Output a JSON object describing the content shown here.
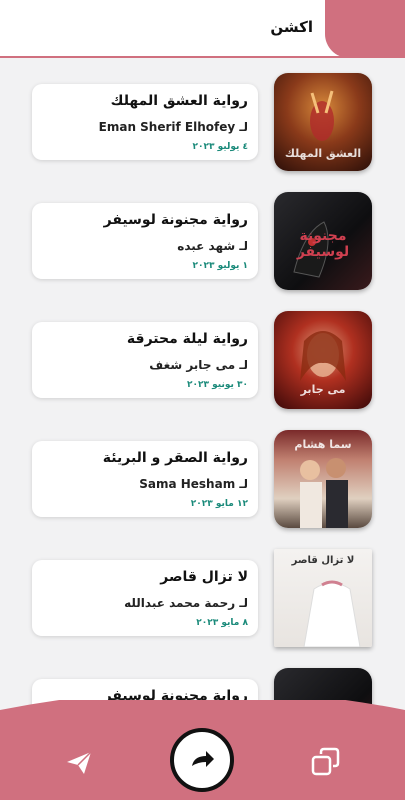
{
  "header": {
    "title": "اكشن"
  },
  "items": [
    {
      "title": "رواية العشق المهلك",
      "author": "لـ Eman Sherif Elhofey",
      "date": "٤ يوليو ٢٠٢٣"
    },
    {
      "title": "رواية مجنونة لوسيفر",
      "author": "لـ شهد عبده",
      "date": "١ يوليو ٢٠٢٣"
    },
    {
      "title": "رواية ليلة محترقة",
      "author": "لـ مى جابر شغف",
      "date": "٣٠ يونيو ٢٠٢٣"
    },
    {
      "title": "رواية الصقر و البريئة",
      "author": "لـ  Sama Hesham",
      "date": "١٢ مايو ٢٠٢٣"
    },
    {
      "title": "لا تزال قاصر",
      "author": "لـ رحمة محمد عبدالله",
      "date": "٨ مايو ٢٠٢٣"
    },
    {
      "title": "رواية مجنونة لوسيفر",
      "author": "",
      "date": ""
    }
  ],
  "covers": [
    {
      "text": "العشق المهلك"
    },
    {
      "text": "مجنونة لوسيفر"
    },
    {
      "text": "مى جابر"
    },
    {
      "text": "سما هشام"
    },
    {
      "text": "لا تزال قاصر"
    },
    {
      "text": ""
    }
  ],
  "nav": {
    "left_icon": "send-icon",
    "center_icon": "share-forward-icon",
    "right_icon": "copy-icon"
  },
  "colors": {
    "accent": "#d0707f",
    "date": "#1a8a7a",
    "background": "#f2f2f3"
  }
}
